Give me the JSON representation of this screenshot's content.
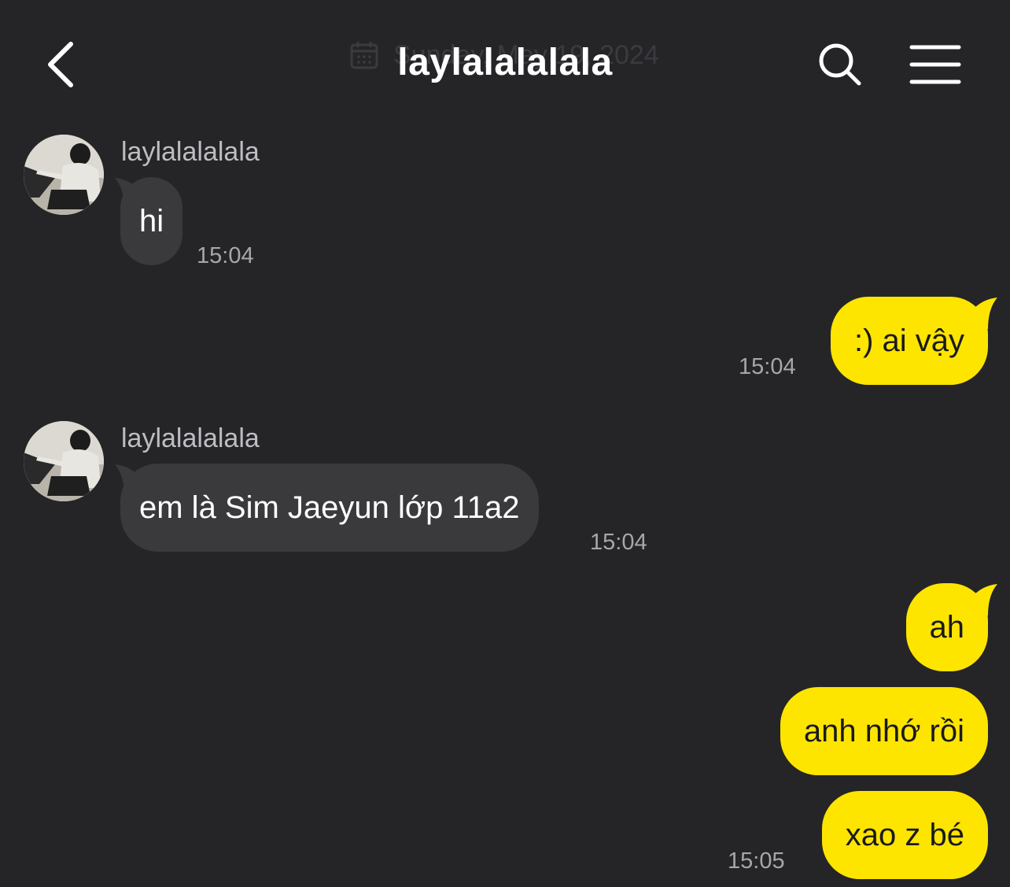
{
  "header": {
    "title": "laylalalalala",
    "date_separator": "Sunday, May 19, 2024"
  },
  "messages": [
    {
      "direction": "incoming",
      "sender": "laylalalalala",
      "text": "hi",
      "time": "15:04"
    },
    {
      "direction": "outgoing",
      "text": ":) ai vậy",
      "time": "15:04"
    },
    {
      "direction": "incoming",
      "sender": "laylalalalala",
      "text": "em là Sim Jaeyun lớp 11a2",
      "time": "15:04"
    },
    {
      "direction": "outgoing",
      "text": "ah",
      "time": ""
    },
    {
      "direction": "outgoing",
      "text": "anh nhớ rồi",
      "time": ""
    },
    {
      "direction": "outgoing",
      "text": "xao z bé",
      "time": "15:05"
    }
  ],
  "icons": {
    "back": "chevron-left-icon",
    "search": "search-icon",
    "menu": "hamburger-menu-icon",
    "calendar": "calendar-icon"
  },
  "colors": {
    "background": "#252528",
    "incoming_bubble": "#3a3a3d",
    "outgoing_bubble": "#fee500",
    "timestamp": "#a7a7ab"
  }
}
